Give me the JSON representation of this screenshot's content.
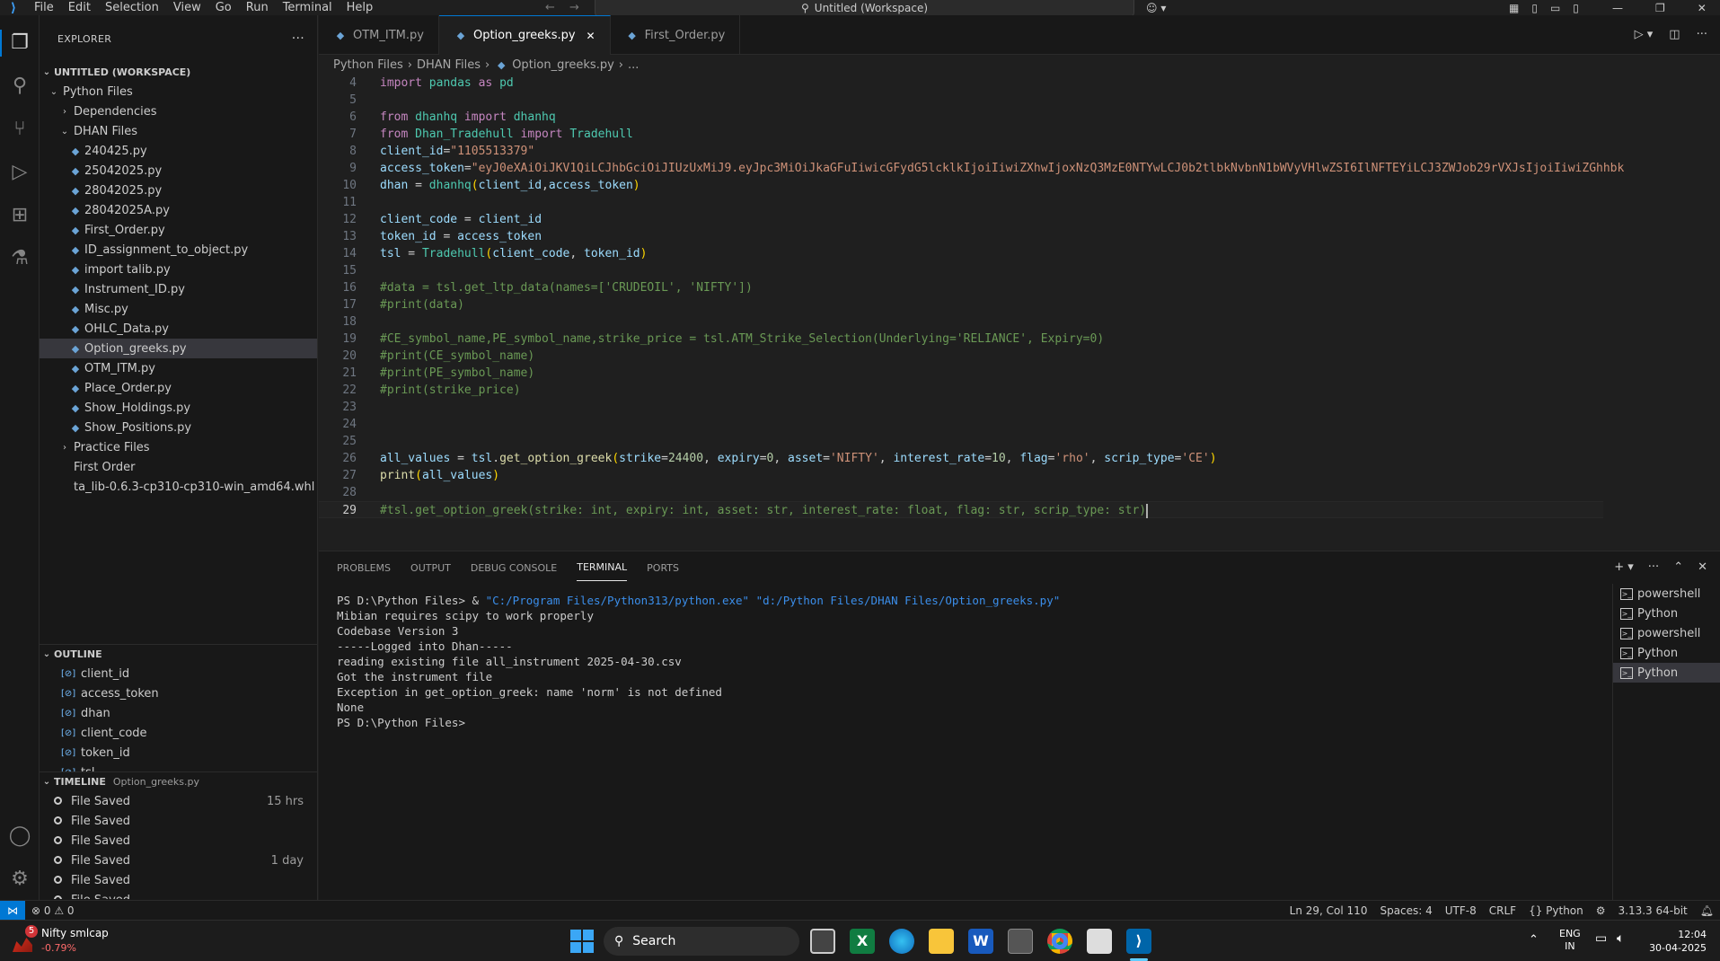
{
  "titlebar": {
    "menu": [
      "File",
      "Edit",
      "Selection",
      "View",
      "Go",
      "Run",
      "Terminal",
      "Help"
    ],
    "search": "Untitled (Workspace)"
  },
  "sidebar": {
    "title": "EXPLORER",
    "workspace": "UNTITLED (WORKSPACE)",
    "tree": [
      {
        "label": "Python Files",
        "depth": 0,
        "type": "folder",
        "open": true
      },
      {
        "label": "Dependencies",
        "depth": 1,
        "type": "folder",
        "open": false
      },
      {
        "label": "DHAN Files",
        "depth": 1,
        "type": "folder",
        "open": true
      },
      {
        "label": "240425.py",
        "depth": 2,
        "type": "py"
      },
      {
        "label": "25042025.py",
        "depth": 2,
        "type": "py"
      },
      {
        "label": "28042025.py",
        "depth": 2,
        "type": "py"
      },
      {
        "label": "28042025A.py",
        "depth": 2,
        "type": "py"
      },
      {
        "label": "First_Order.py",
        "depth": 2,
        "type": "py"
      },
      {
        "label": "ID_assignment_to_object.py",
        "depth": 2,
        "type": "py"
      },
      {
        "label": "import talib.py",
        "depth": 2,
        "type": "py"
      },
      {
        "label": "Instrument_ID.py",
        "depth": 2,
        "type": "py"
      },
      {
        "label": "Misc.py",
        "depth": 2,
        "type": "py"
      },
      {
        "label": "OHLC_Data.py",
        "depth": 2,
        "type": "py"
      },
      {
        "label": "Option_greeks.py",
        "depth": 2,
        "type": "py",
        "selected": true
      },
      {
        "label": "OTM_ITM.py",
        "depth": 2,
        "type": "py"
      },
      {
        "label": "Place_Order.py",
        "depth": 2,
        "type": "py"
      },
      {
        "label": "Show_Holdings.py",
        "depth": 2,
        "type": "py"
      },
      {
        "label": "Show_Positions.py",
        "depth": 2,
        "type": "py"
      },
      {
        "label": "Practice Files",
        "depth": 1,
        "type": "folder",
        "open": false
      },
      {
        "label": "First Order",
        "depth": 1,
        "type": "file"
      },
      {
        "label": "ta_lib-0.6.3-cp310-cp310-win_amd64.whl",
        "depth": 1,
        "type": "file"
      }
    ],
    "outline_title": "OUTLINE",
    "outline": [
      "client_id",
      "access_token",
      "dhan",
      "client_code",
      "token_id",
      "tsl"
    ],
    "timeline_title": "TIMELINE",
    "timeline_file": "Option_greeks.py",
    "timeline": [
      {
        "label": "File Saved",
        "time": "15 hrs"
      },
      {
        "label": "File Saved",
        "time": ""
      },
      {
        "label": "File Saved",
        "time": ""
      },
      {
        "label": "File Saved",
        "time": "1 day"
      },
      {
        "label": "File Saved",
        "time": ""
      },
      {
        "label": "File Saved",
        "time": ""
      }
    ]
  },
  "tabs": [
    {
      "label": "OTM_ITM.py",
      "active": false
    },
    {
      "label": "Option_greeks.py",
      "active": true
    },
    {
      "label": "First_Order.py",
      "active": false
    }
  ],
  "breadcrumb": [
    "Python Files",
    "DHAN Files",
    "Option_greeks.py",
    "..."
  ],
  "editor": {
    "lines": [
      {
        "n": "4",
        "t": [
          [
            "kw",
            "import "
          ],
          [
            "mod",
            "pandas"
          ],
          [
            "kw",
            " as "
          ],
          [
            "mod",
            "pd"
          ]
        ]
      },
      {
        "n": "5",
        "t": []
      },
      {
        "n": "6",
        "t": [
          [
            "kw",
            "from "
          ],
          [
            "mod",
            "dhanhq"
          ],
          [
            "kw",
            " import "
          ],
          [
            "mod",
            "dhanhq"
          ]
        ]
      },
      {
        "n": "7",
        "t": [
          [
            "kw",
            "from "
          ],
          [
            "mod",
            "Dhan_Tradehull"
          ],
          [
            "kw",
            " import "
          ],
          [
            "mod",
            "Tradehull"
          ]
        ]
      },
      {
        "n": "8",
        "t": [
          [
            "v",
            "client_id"
          ],
          [
            "p",
            "="
          ],
          [
            "s",
            "\"1105513379\""
          ]
        ]
      },
      {
        "n": "9",
        "t": [
          [
            "v",
            "access_token"
          ],
          [
            "p",
            "="
          ],
          [
            "s",
            "\"eyJ0eXAiOiJKV1QiLCJhbGciOiJIUzUxMiJ9.eyJpc3MiOiJkaGFuIiwicGFydG5lcklkIjoiIiwiZXhwIjoxNzQ3MzE0NTYwLCJ0b2tlbkNvbnN1bWVyVHlwZSI6IlNFTEYiLCJ3ZWJob29rVXJsIjoiIiwiZGhhbk"
          ]
        ]
      },
      {
        "n": "10",
        "t": [
          [
            "v",
            "dhan"
          ],
          [
            "p",
            " = "
          ],
          [
            "mod",
            "dhanhq"
          ],
          [
            "br",
            "("
          ],
          [
            "v",
            "client_id"
          ],
          [
            "p",
            ","
          ],
          [
            "v",
            "access_token"
          ],
          [
            "br",
            ")"
          ]
        ]
      },
      {
        "n": "11",
        "t": []
      },
      {
        "n": "12",
        "t": [
          [
            "v",
            "client_code"
          ],
          [
            "p",
            " = "
          ],
          [
            "v",
            "client_id"
          ]
        ]
      },
      {
        "n": "13",
        "t": [
          [
            "v",
            "token_id"
          ],
          [
            "p",
            " = "
          ],
          [
            "v",
            "access_token"
          ]
        ]
      },
      {
        "n": "14",
        "t": [
          [
            "v",
            "tsl"
          ],
          [
            "p",
            " = "
          ],
          [
            "mod",
            "Tradehull"
          ],
          [
            "br",
            "("
          ],
          [
            "v",
            "client_code"
          ],
          [
            "p",
            ", "
          ],
          [
            "v",
            "token_id"
          ],
          [
            "br",
            ")"
          ]
        ]
      },
      {
        "n": "15",
        "t": []
      },
      {
        "n": "16",
        "t": [
          [
            "c",
            "#data = tsl.get_ltp_data(names=['CRUDEOIL', 'NIFTY'])"
          ]
        ]
      },
      {
        "n": "17",
        "t": [
          [
            "c",
            "#print(data)"
          ]
        ]
      },
      {
        "n": "18",
        "t": []
      },
      {
        "n": "19",
        "t": [
          [
            "c",
            "#CE_symbol_name,PE_symbol_name,strike_price = tsl.ATM_Strike_Selection(Underlying='RELIANCE', Expiry=0)"
          ]
        ]
      },
      {
        "n": "20",
        "t": [
          [
            "c",
            "#print(CE_symbol_name)"
          ]
        ]
      },
      {
        "n": "21",
        "t": [
          [
            "c",
            "#print(PE_symbol_name)"
          ]
        ]
      },
      {
        "n": "22",
        "t": [
          [
            "c",
            "#print(strike_price)"
          ]
        ]
      },
      {
        "n": "23",
        "t": []
      },
      {
        "n": "24",
        "t": []
      },
      {
        "n": "25",
        "t": []
      },
      {
        "n": "26",
        "t": [
          [
            "v",
            "all_values"
          ],
          [
            "p",
            " = "
          ],
          [
            "v",
            "tsl"
          ],
          [
            "p",
            "."
          ],
          [
            "f",
            "get_option_greek"
          ],
          [
            "br",
            "("
          ],
          [
            "v",
            "strike"
          ],
          [
            "p",
            "="
          ],
          [
            "n",
            "24400"
          ],
          [
            "p",
            ", "
          ],
          [
            "v",
            "expiry"
          ],
          [
            "p",
            "="
          ],
          [
            "n",
            "0"
          ],
          [
            "p",
            ", "
          ],
          [
            "v",
            "asset"
          ],
          [
            "p",
            "="
          ],
          [
            "s",
            "'NIFTY'"
          ],
          [
            "p",
            ", "
          ],
          [
            "v",
            "interest_rate"
          ],
          [
            "p",
            "="
          ],
          [
            "n",
            "10"
          ],
          [
            "p",
            ", "
          ],
          [
            "v",
            "flag"
          ],
          [
            "p",
            "="
          ],
          [
            "s",
            "'rho'"
          ],
          [
            "p",
            ", "
          ],
          [
            "v",
            "scrip_type"
          ],
          [
            "p",
            "="
          ],
          [
            "s",
            "'CE'"
          ],
          [
            "br",
            ")"
          ]
        ]
      },
      {
        "n": "27",
        "t": [
          [
            "f",
            "print"
          ],
          [
            "br",
            "("
          ],
          [
            "v",
            "all_values"
          ],
          [
            "br",
            ")"
          ]
        ]
      },
      {
        "n": "28",
        "t": []
      },
      {
        "n": "29",
        "t": [
          [
            "c",
            "#tsl.get_option_greek(strike: int, expiry: int, asset: str, interest_rate: float, flag: str, scrip_type: str)"
          ]
        ],
        "current": true
      }
    ]
  },
  "panel": {
    "tabs": [
      {
        "label": "PROBLEMS",
        "active": false
      },
      {
        "label": "OUTPUT",
        "active": false
      },
      {
        "label": "DEBUG CONSOLE",
        "active": false
      },
      {
        "label": "TERMINAL",
        "active": true
      },
      {
        "label": "PORTS",
        "active": false
      }
    ],
    "terminal_prompt": "PS D:\\Python Files> ",
    "terminal_cmd_amp": "& ",
    "terminal_cmd_exe": "\"C:/Program Files/Python313/python.exe\"",
    "terminal_cmd_file": " \"d:/Python Files/DHAN Files/Option_greeks.py\"",
    "terminal_output": [
      "Mibian requires scipy to work properly",
      "Codebase Version 3",
      "-----Logged into Dhan-----",
      "reading existing file all_instrument 2025-04-30.csv",
      "Got the instrument file",
      "Exception in get_option_greek: name 'norm' is not defined",
      "None",
      "PS D:\\Python Files>"
    ],
    "terminals": [
      {
        "label": "powershell",
        "active": false
      },
      {
        "label": "Python",
        "active": false
      },
      {
        "label": "powershell",
        "active": false
      },
      {
        "label": "Python",
        "active": false
      },
      {
        "label": "Python",
        "active": true
      }
    ]
  },
  "statusbar": {
    "problems": "⊗ 0 ⚠ 0",
    "position": "Ln 29, Col 110",
    "spaces": "Spaces: 4",
    "encoding": "UTF-8",
    "eol": "CRLF",
    "language": "{} Python",
    "interpreter": "3.13.3 64-bit"
  },
  "taskbar": {
    "widget_badge": "5",
    "widget_title": "Nifty smlcap",
    "widget_value": "-0.79%",
    "search": "Search",
    "lang1": "ENG",
    "lang2": "IN",
    "time": "12:04",
    "date": "30-04-2025"
  },
  "colors": {
    "accent": "#0078d4",
    "editor_bg": "#1f1f1f",
    "sidebar_bg": "#181818",
    "selection": "#37373d"
  }
}
